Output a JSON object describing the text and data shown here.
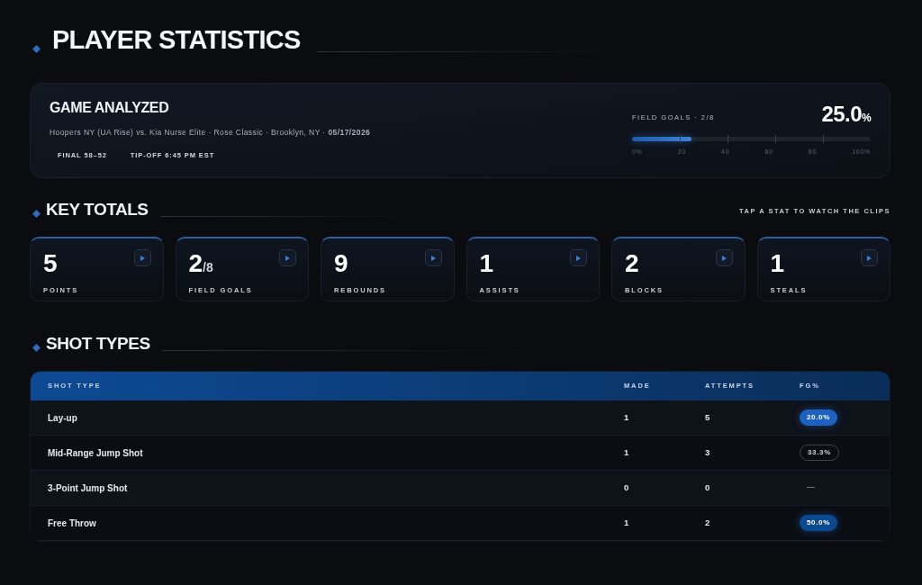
{
  "page_title": "PLAYER STATISTICS",
  "game_card": {
    "title": "GAME ANALYZED",
    "details": "Hoopers NY (UA Rise) vs. Kia Nurse Elite · Rose Classic · Brooklyn, NY · **05/17/2026**",
    "chips": [
      "FINAL 58–52",
      "TIP-OFF 6:45 PM EST"
    ],
    "field_goals": {
      "label": "FIELD GOALS · 2/8",
      "value": "25.0",
      "unit": "%",
      "level": 0.25,
      "scale": [
        "0%",
        "20",
        "40",
        "60",
        "80",
        "100%"
      ]
    }
  },
  "key_totals": {
    "title": "KEY TOTALS",
    "hint": "TAP A STAT TO WATCH THE CLIPS",
    "stats": [
      {
        "value": "5",
        "label": "POINTS"
      },
      {
        "value": "2",
        "suffix": "/8",
        "label": "FIELD GOALS"
      },
      {
        "value": "9",
        "label": "REBOUNDS"
      },
      {
        "value": "1",
        "label": "ASSISTS"
      },
      {
        "value": "2",
        "label": "BLOCKS"
      },
      {
        "value": "1",
        "label": "STEALS"
      }
    ]
  },
  "shot_types": {
    "title": "SHOT TYPES",
    "table": {
      "columns": [
        "SHOT TYPE",
        "MADE",
        "ATTEMPTS",
        "FG%"
      ],
      "rows": [
        {
          "shot_type": "Lay-up",
          "made": "1",
          "attempts": "5",
          "fg": {
            "kind": "filled",
            "text": "20.0%",
            "color": "#1c62c2"
          }
        },
        {
          "shot_type": "Mid-Range Jump Shot",
          "made": "1",
          "attempts": "3",
          "fg": {
            "kind": "outline",
            "text": "33.3%"
          }
        },
        {
          "shot_type": "3-Point Jump Shot",
          "made": "0",
          "attempts": "0",
          "fg": {
            "kind": "plain",
            "text": "—"
          }
        },
        {
          "shot_type": "Free Throw",
          "made": "1",
          "attempts": "2",
          "fg": {
            "kind": "filled",
            "text": "50.0%",
            "color": "#0b4a90"
          }
        }
      ]
    }
  }
}
